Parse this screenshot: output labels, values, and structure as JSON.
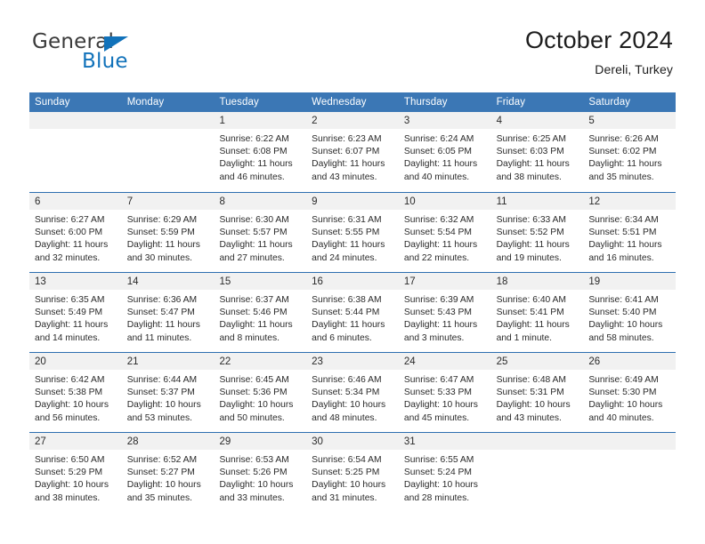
{
  "brand": {
    "name_top": "General",
    "name_bottom": "Blue",
    "accent_color": "#1172BA"
  },
  "header": {
    "title": "October 2024",
    "subtitle": "Dereli, Turkey"
  },
  "calendar": {
    "header_bg": "#3B77B5",
    "divider_color": "#2D6FB0",
    "daynumber_bg": "#F1F1F1",
    "weekdays": [
      "Sunday",
      "Monday",
      "Tuesday",
      "Wednesday",
      "Thursday",
      "Friday",
      "Saturday"
    ],
    "labels": {
      "sunrise": "Sunrise:",
      "sunset": "Sunset:",
      "daylight": "Daylight:"
    },
    "weeks": [
      [
        {
          "day": "",
          "empty": true
        },
        {
          "day": "",
          "empty": true
        },
        {
          "day": "1",
          "sunrise": "Sunrise: 6:22 AM",
          "sunset": "Sunset: 6:08 PM",
          "daylight": "Daylight: 11 hours and 46 minutes."
        },
        {
          "day": "2",
          "sunrise": "Sunrise: 6:23 AM",
          "sunset": "Sunset: 6:07 PM",
          "daylight": "Daylight: 11 hours and 43 minutes."
        },
        {
          "day": "3",
          "sunrise": "Sunrise: 6:24 AM",
          "sunset": "Sunset: 6:05 PM",
          "daylight": "Daylight: 11 hours and 40 minutes."
        },
        {
          "day": "4",
          "sunrise": "Sunrise: 6:25 AM",
          "sunset": "Sunset: 6:03 PM",
          "daylight": "Daylight: 11 hours and 38 minutes."
        },
        {
          "day": "5",
          "sunrise": "Sunrise: 6:26 AM",
          "sunset": "Sunset: 6:02 PM",
          "daylight": "Daylight: 11 hours and 35 minutes."
        }
      ],
      [
        {
          "day": "6",
          "sunrise": "Sunrise: 6:27 AM",
          "sunset": "Sunset: 6:00 PM",
          "daylight": "Daylight: 11 hours and 32 minutes."
        },
        {
          "day": "7",
          "sunrise": "Sunrise: 6:29 AM",
          "sunset": "Sunset: 5:59 PM",
          "daylight": "Daylight: 11 hours and 30 minutes."
        },
        {
          "day": "8",
          "sunrise": "Sunrise: 6:30 AM",
          "sunset": "Sunset: 5:57 PM",
          "daylight": "Daylight: 11 hours and 27 minutes."
        },
        {
          "day": "9",
          "sunrise": "Sunrise: 6:31 AM",
          "sunset": "Sunset: 5:55 PM",
          "daylight": "Daylight: 11 hours and 24 minutes."
        },
        {
          "day": "10",
          "sunrise": "Sunrise: 6:32 AM",
          "sunset": "Sunset: 5:54 PM",
          "daylight": "Daylight: 11 hours and 22 minutes."
        },
        {
          "day": "11",
          "sunrise": "Sunrise: 6:33 AM",
          "sunset": "Sunset: 5:52 PM",
          "daylight": "Daylight: 11 hours and 19 minutes."
        },
        {
          "day": "12",
          "sunrise": "Sunrise: 6:34 AM",
          "sunset": "Sunset: 5:51 PM",
          "daylight": "Daylight: 11 hours and 16 minutes."
        }
      ],
      [
        {
          "day": "13",
          "sunrise": "Sunrise: 6:35 AM",
          "sunset": "Sunset: 5:49 PM",
          "daylight": "Daylight: 11 hours and 14 minutes."
        },
        {
          "day": "14",
          "sunrise": "Sunrise: 6:36 AM",
          "sunset": "Sunset: 5:47 PM",
          "daylight": "Daylight: 11 hours and 11 minutes."
        },
        {
          "day": "15",
          "sunrise": "Sunrise: 6:37 AM",
          "sunset": "Sunset: 5:46 PM",
          "daylight": "Daylight: 11 hours and 8 minutes."
        },
        {
          "day": "16",
          "sunrise": "Sunrise: 6:38 AM",
          "sunset": "Sunset: 5:44 PM",
          "daylight": "Daylight: 11 hours and 6 minutes."
        },
        {
          "day": "17",
          "sunrise": "Sunrise: 6:39 AM",
          "sunset": "Sunset: 5:43 PM",
          "daylight": "Daylight: 11 hours and 3 minutes."
        },
        {
          "day": "18",
          "sunrise": "Sunrise: 6:40 AM",
          "sunset": "Sunset: 5:41 PM",
          "daylight": "Daylight: 11 hours and 1 minute."
        },
        {
          "day": "19",
          "sunrise": "Sunrise: 6:41 AM",
          "sunset": "Sunset: 5:40 PM",
          "daylight": "Daylight: 10 hours and 58 minutes."
        }
      ],
      [
        {
          "day": "20",
          "sunrise": "Sunrise: 6:42 AM",
          "sunset": "Sunset: 5:38 PM",
          "daylight": "Daylight: 10 hours and 56 minutes."
        },
        {
          "day": "21",
          "sunrise": "Sunrise: 6:44 AM",
          "sunset": "Sunset: 5:37 PM",
          "daylight": "Daylight: 10 hours and 53 minutes."
        },
        {
          "day": "22",
          "sunrise": "Sunrise: 6:45 AM",
          "sunset": "Sunset: 5:36 PM",
          "daylight": "Daylight: 10 hours and 50 minutes."
        },
        {
          "day": "23",
          "sunrise": "Sunrise: 6:46 AM",
          "sunset": "Sunset: 5:34 PM",
          "daylight": "Daylight: 10 hours and 48 minutes."
        },
        {
          "day": "24",
          "sunrise": "Sunrise: 6:47 AM",
          "sunset": "Sunset: 5:33 PM",
          "daylight": "Daylight: 10 hours and 45 minutes."
        },
        {
          "day": "25",
          "sunrise": "Sunrise: 6:48 AM",
          "sunset": "Sunset: 5:31 PM",
          "daylight": "Daylight: 10 hours and 43 minutes."
        },
        {
          "day": "26",
          "sunrise": "Sunrise: 6:49 AM",
          "sunset": "Sunset: 5:30 PM",
          "daylight": "Daylight: 10 hours and 40 minutes."
        }
      ],
      [
        {
          "day": "27",
          "sunrise": "Sunrise: 6:50 AM",
          "sunset": "Sunset: 5:29 PM",
          "daylight": "Daylight: 10 hours and 38 minutes."
        },
        {
          "day": "28",
          "sunrise": "Sunrise: 6:52 AM",
          "sunset": "Sunset: 5:27 PM",
          "daylight": "Daylight: 10 hours and 35 minutes."
        },
        {
          "day": "29",
          "sunrise": "Sunrise: 6:53 AM",
          "sunset": "Sunset: 5:26 PM",
          "daylight": "Daylight: 10 hours and 33 minutes."
        },
        {
          "day": "30",
          "sunrise": "Sunrise: 6:54 AM",
          "sunset": "Sunset: 5:25 PM",
          "daylight": "Daylight: 10 hours and 31 minutes."
        },
        {
          "day": "31",
          "sunrise": "Sunrise: 6:55 AM",
          "sunset": "Sunset: 5:24 PM",
          "daylight": "Daylight: 10 hours and 28 minutes."
        },
        {
          "day": "",
          "empty": true
        },
        {
          "day": "",
          "empty": true
        }
      ]
    ]
  }
}
